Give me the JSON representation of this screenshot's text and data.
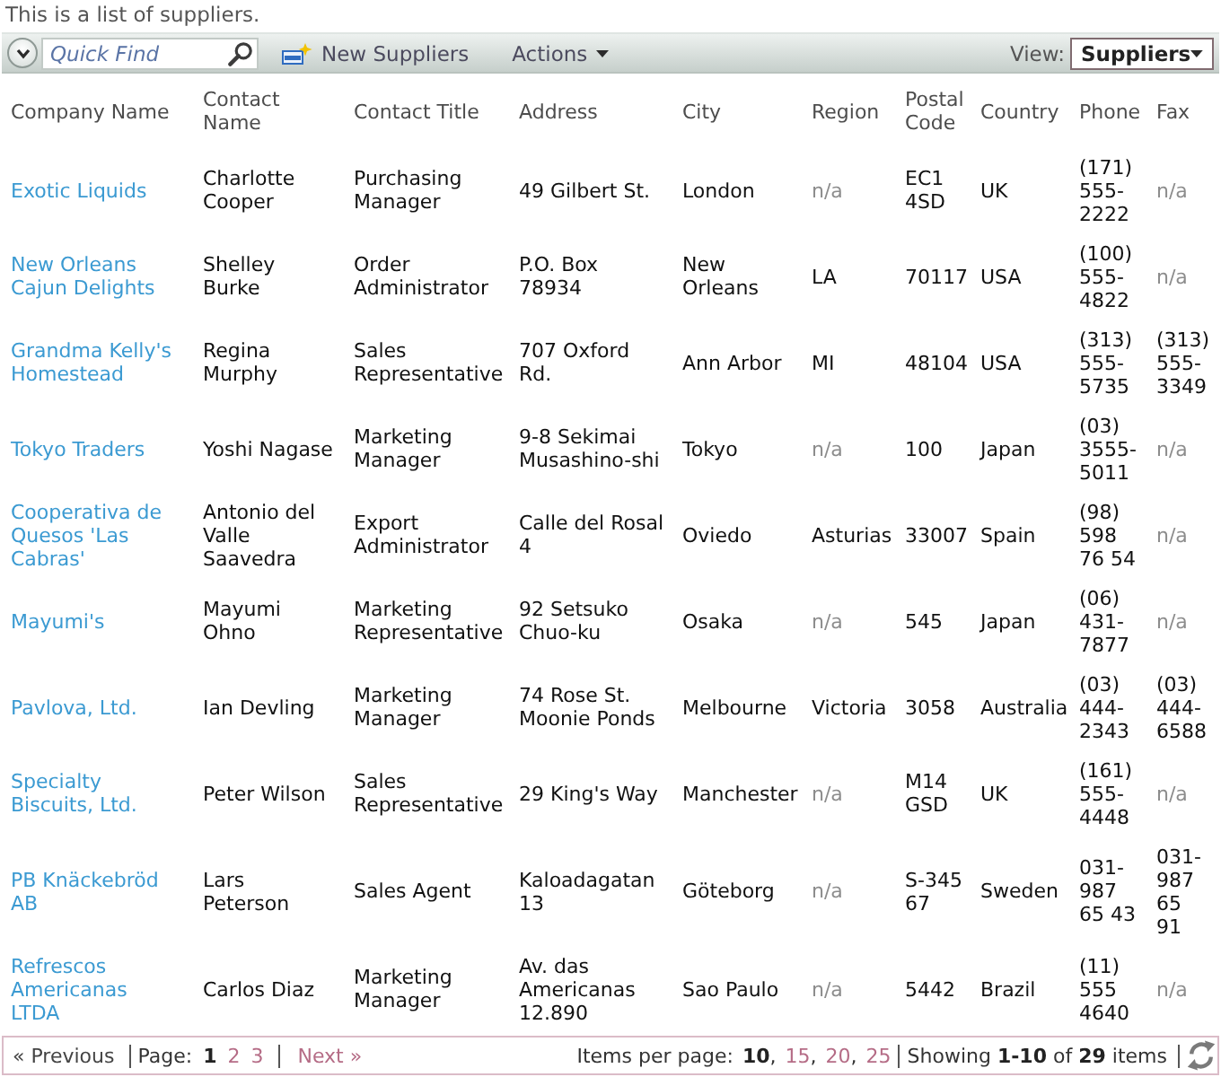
{
  "description": "This is a list of suppliers.",
  "toolbar": {
    "quick_find": {
      "placeholder": "Quick Find"
    },
    "new_button": "New Suppliers",
    "actions_menu": "Actions",
    "view": {
      "label": "View:",
      "value": "Suppliers"
    }
  },
  "table": {
    "columns": [
      "Company Name",
      "Contact Name",
      "Contact Title",
      "Address",
      "City",
      "Region",
      "Postal Code",
      "Country",
      "Phone",
      "Fax"
    ],
    "rows": [
      {
        "cells": [
          {
            "text": "Exotic Liquids",
            "kind": "link"
          },
          {
            "text": "Charlotte Cooper",
            "kind": "text"
          },
          {
            "text": "Purchasing Manager",
            "kind": "text"
          },
          {
            "text": "49 Gilbert St.",
            "kind": "text"
          },
          {
            "text": "London",
            "kind": "text"
          },
          {
            "text": "n/a",
            "kind": "empty"
          },
          {
            "text": "EC1 4SD",
            "kind": "text"
          },
          {
            "text": "UK",
            "kind": "text"
          },
          {
            "text": "(171) 555-2222",
            "kind": "text"
          },
          {
            "text": "n/a",
            "kind": "empty"
          }
        ]
      },
      {
        "cells": [
          {
            "text": "New Orleans Cajun Delights",
            "kind": "link"
          },
          {
            "text": "Shelley Burke",
            "kind": "text"
          },
          {
            "text": "Order Administrator",
            "kind": "text"
          },
          {
            "text": "P.O. Box 78934",
            "kind": "text"
          },
          {
            "text": "New Orleans",
            "kind": "text"
          },
          {
            "text": "LA",
            "kind": "text"
          },
          {
            "text": "70117",
            "kind": "text"
          },
          {
            "text": "USA",
            "kind": "text"
          },
          {
            "text": "(100) 555-4822",
            "kind": "text"
          },
          {
            "text": "n/a",
            "kind": "empty"
          }
        ]
      },
      {
        "cells": [
          {
            "text": "Grandma Kelly's Homestead",
            "kind": "link"
          },
          {
            "text": "Regina Murphy",
            "kind": "text"
          },
          {
            "text": "Sales Representative",
            "kind": "text"
          },
          {
            "text": "707 Oxford Rd.",
            "kind": "text"
          },
          {
            "text": "Ann Arbor",
            "kind": "text"
          },
          {
            "text": "MI",
            "kind": "text"
          },
          {
            "text": "48104",
            "kind": "text"
          },
          {
            "text": "USA",
            "kind": "text"
          },
          {
            "text": "(313) 555-5735",
            "kind": "text"
          },
          {
            "text": "(313) 555-3349",
            "kind": "text"
          }
        ]
      },
      {
        "cells": [
          {
            "text": "Tokyo Traders",
            "kind": "link"
          },
          {
            "text": "Yoshi Nagase",
            "kind": "text"
          },
          {
            "text": "Marketing Manager",
            "kind": "text"
          },
          {
            "text": "9-8 Sekimai Musashino-shi",
            "kind": "text"
          },
          {
            "text": "Tokyo",
            "kind": "text"
          },
          {
            "text": "n/a",
            "kind": "empty"
          },
          {
            "text": "100",
            "kind": "text"
          },
          {
            "text": "Japan",
            "kind": "text"
          },
          {
            "text": "(03) 3555-5011",
            "kind": "text"
          },
          {
            "text": "n/a",
            "kind": "empty"
          }
        ]
      },
      {
        "cells": [
          {
            "text": "Cooperativa de Quesos 'Las Cabras'",
            "kind": "link"
          },
          {
            "text": "Antonio del Valle Saavedra",
            "kind": "text"
          },
          {
            "text": "Export Administrator",
            "kind": "text"
          },
          {
            "text": "Calle del Rosal 4",
            "kind": "text"
          },
          {
            "text": "Oviedo",
            "kind": "text"
          },
          {
            "text": "Asturias",
            "kind": "text"
          },
          {
            "text": "33007",
            "kind": "text"
          },
          {
            "text": "Spain",
            "kind": "text"
          },
          {
            "text": "(98) 598 76 54",
            "kind": "text"
          },
          {
            "text": "n/a",
            "kind": "empty"
          }
        ]
      },
      {
        "cells": [
          {
            "text": "Mayumi's",
            "kind": "link"
          },
          {
            "text": "Mayumi Ohno",
            "kind": "text"
          },
          {
            "text": "Marketing Representative",
            "kind": "text"
          },
          {
            "text": "92 Setsuko Chuo-ku",
            "kind": "text"
          },
          {
            "text": "Osaka",
            "kind": "text"
          },
          {
            "text": "n/a",
            "kind": "empty"
          },
          {
            "text": "545",
            "kind": "text"
          },
          {
            "text": "Japan",
            "kind": "text"
          },
          {
            "text": "(06) 431-7877",
            "kind": "text"
          },
          {
            "text": "n/a",
            "kind": "empty"
          }
        ]
      },
      {
        "cells": [
          {
            "text": "Pavlova, Ltd.",
            "kind": "link"
          },
          {
            "text": "Ian Devling",
            "kind": "text"
          },
          {
            "text": "Marketing Manager",
            "kind": "text"
          },
          {
            "text": "74 Rose St. Moonie Ponds",
            "kind": "text"
          },
          {
            "text": "Melbourne",
            "kind": "text"
          },
          {
            "text": "Victoria",
            "kind": "text"
          },
          {
            "text": "3058",
            "kind": "text"
          },
          {
            "text": "Australia",
            "kind": "text"
          },
          {
            "text": "(03) 444-2343",
            "kind": "text"
          },
          {
            "text": "(03) 444-6588",
            "kind": "text"
          }
        ]
      },
      {
        "cells": [
          {
            "text": "Specialty Biscuits, Ltd.",
            "kind": "link"
          },
          {
            "text": "Peter Wilson",
            "kind": "text"
          },
          {
            "text": "Sales Representative",
            "kind": "text"
          },
          {
            "text": "29 King's Way",
            "kind": "text"
          },
          {
            "text": "Manchester",
            "kind": "text"
          },
          {
            "text": "n/a",
            "kind": "empty"
          },
          {
            "text": "M14 GSD",
            "kind": "text"
          },
          {
            "text": "UK",
            "kind": "text"
          },
          {
            "text": "(161) 555-4448",
            "kind": "text"
          },
          {
            "text": "n/a",
            "kind": "empty"
          }
        ]
      },
      {
        "cells": [
          {
            "text": "PB Knäckebröd AB",
            "kind": "link"
          },
          {
            "text": "Lars Peterson",
            "kind": "text"
          },
          {
            "text": "Sales Agent",
            "kind": "text"
          },
          {
            "text": "Kaloadagatan 13",
            "kind": "text"
          },
          {
            "text": "Göteborg",
            "kind": "text"
          },
          {
            "text": "n/a",
            "kind": "empty"
          },
          {
            "text": "S-345 67",
            "kind": "text"
          },
          {
            "text": "Sweden",
            "kind": "text"
          },
          {
            "text": "031-987 65 43",
            "kind": "text"
          },
          {
            "text": "031-987 65 91",
            "kind": "text"
          }
        ]
      },
      {
        "cells": [
          {
            "text": "Refrescos Americanas LTDA",
            "kind": "link"
          },
          {
            "text": "Carlos Diaz",
            "kind": "text"
          },
          {
            "text": "Marketing Manager",
            "kind": "text"
          },
          {
            "text": "Av. das Americanas 12.890",
            "kind": "text"
          },
          {
            "text": "Sao Paulo",
            "kind": "text"
          },
          {
            "text": "n/a",
            "kind": "empty"
          },
          {
            "text": "5442",
            "kind": "text"
          },
          {
            "text": "Brazil",
            "kind": "text"
          },
          {
            "text": "(11) 555 4640",
            "kind": "text"
          },
          {
            "text": "n/a",
            "kind": "empty"
          }
        ]
      }
    ]
  },
  "pager": {
    "previous": {
      "label": "« Previous",
      "disabled": true
    },
    "page_label": "Page:",
    "pages": [
      {
        "label": "1",
        "selected": true
      },
      {
        "label": "2",
        "selected": false
      },
      {
        "label": "3",
        "selected": false
      }
    ],
    "next": {
      "label": "Next »",
      "disabled": false
    },
    "items_per_page_label": "Items per page:",
    "page_sizes": [
      {
        "label": "10",
        "selected": true,
        "separator": ","
      },
      {
        "label": "15",
        "selected": false,
        "separator": ","
      },
      {
        "label": "20",
        "selected": false,
        "separator": ","
      },
      {
        "label": "25",
        "selected": false
      }
    ],
    "summary": "Showing **1-10** of **29** items"
  }
}
